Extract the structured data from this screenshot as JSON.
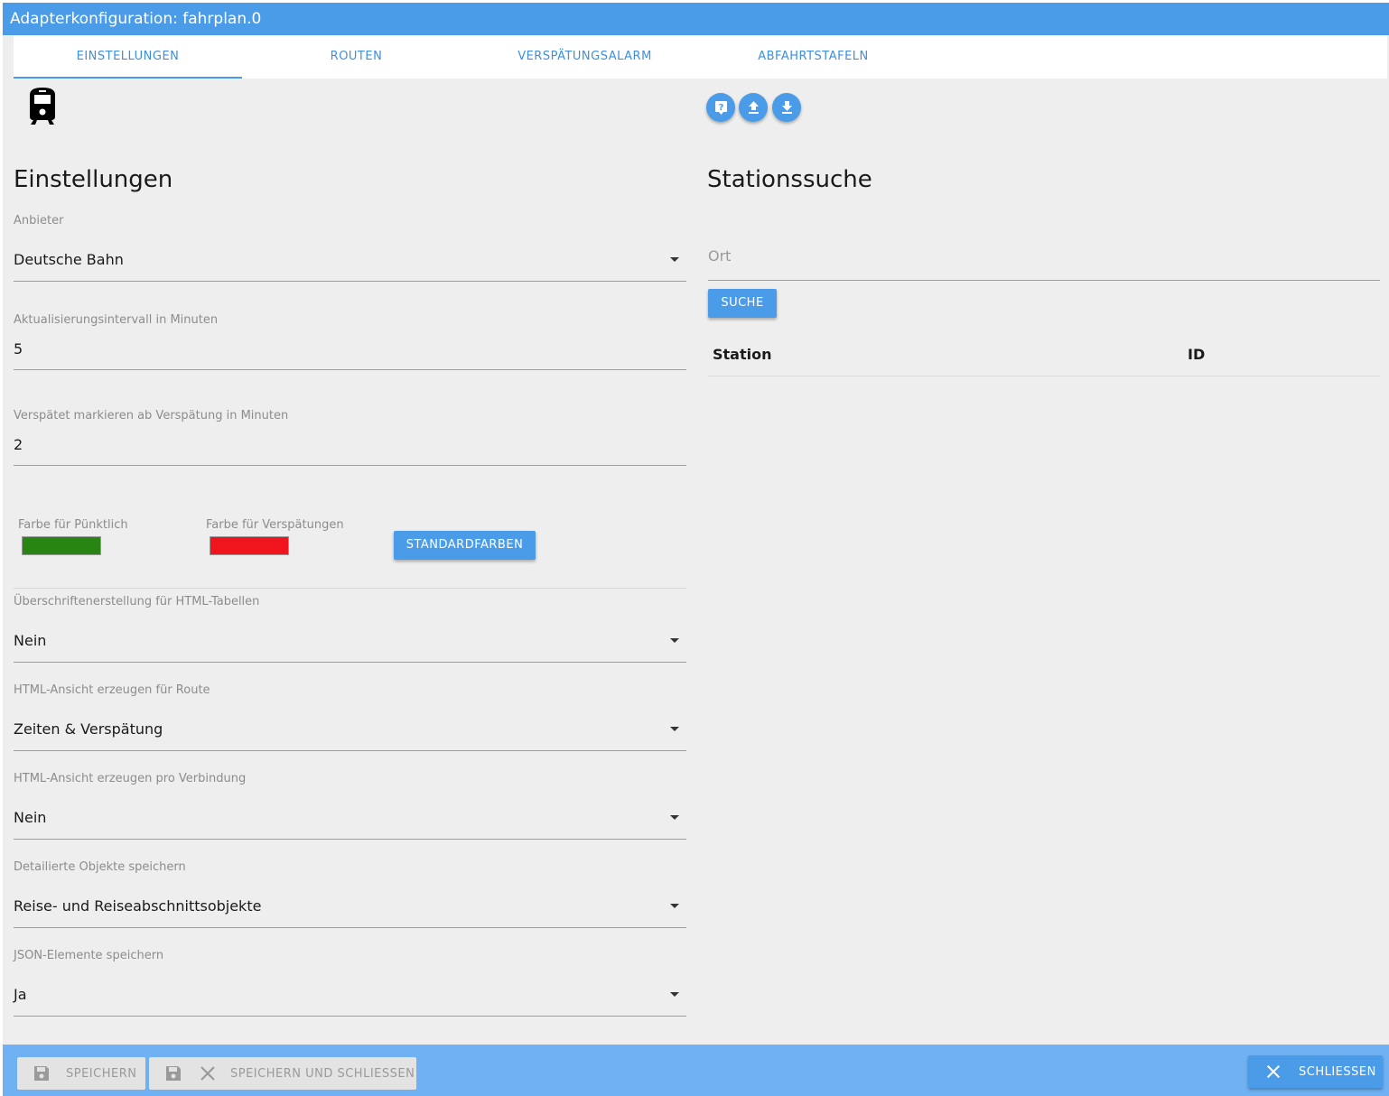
{
  "window": {
    "title": "Adapterkonfiguration: fahrplan.0"
  },
  "tabs": [
    {
      "label": "EINSTELLUNGEN",
      "active": true
    },
    {
      "label": "ROUTEN",
      "active": false
    },
    {
      "label": "VERSPÄTUNGSALARM",
      "active": false
    },
    {
      "label": "ABFAHRTSTAFELN",
      "active": false
    }
  ],
  "icons": {
    "logo": "train-icon",
    "actions": [
      "help-icon",
      "upload-icon",
      "download-icon"
    ]
  },
  "settings": {
    "heading": "Einstellungen",
    "anbieter": {
      "label": "Anbieter",
      "value": "Deutsche Bahn"
    },
    "interval": {
      "label": "Aktualisierungsintervall in Minuten",
      "value": "5"
    },
    "delay": {
      "label": "Verspätet markieren ab Verspätung in Minuten",
      "value": "2"
    },
    "colors": {
      "ontime_label": "Farbe für Pünktlich",
      "ontime_color": "#288413",
      "delay_label": "Farbe für Verspätungen",
      "delay_color": "#f0141c",
      "default_button": "STANDARDFARBEN"
    },
    "header_creation": {
      "label": "Überschriftenerstellung für HTML-Tabellen",
      "value": "Nein"
    },
    "html_route": {
      "label": "HTML-Ansicht erzeugen für Route",
      "value": "Zeiten & Verspätung"
    },
    "html_connection": {
      "label": "HTML-Ansicht erzeugen pro Verbindung",
      "value": "Nein"
    },
    "detailed_objects": {
      "label": "Detailierte Objekte speichern",
      "value": "Reise- und Reiseabschnittsobjekte"
    },
    "json_elements": {
      "label": "JSON-Elemente speichern",
      "value": "Ja"
    }
  },
  "station_search": {
    "heading": "Stationssuche",
    "placeholder": "Ort",
    "button": "SUCHE",
    "columns": [
      "Station",
      "ID"
    ]
  },
  "footer": {
    "save": "SPEICHERN",
    "save_close": "SPEICHERN UND SCHLIESSEN",
    "close": "SCHLIESSEN"
  },
  "colors": {
    "accent": "#4a9be8",
    "footer_bg": "#6fb1f2",
    "content_bg": "#eeeeee"
  }
}
